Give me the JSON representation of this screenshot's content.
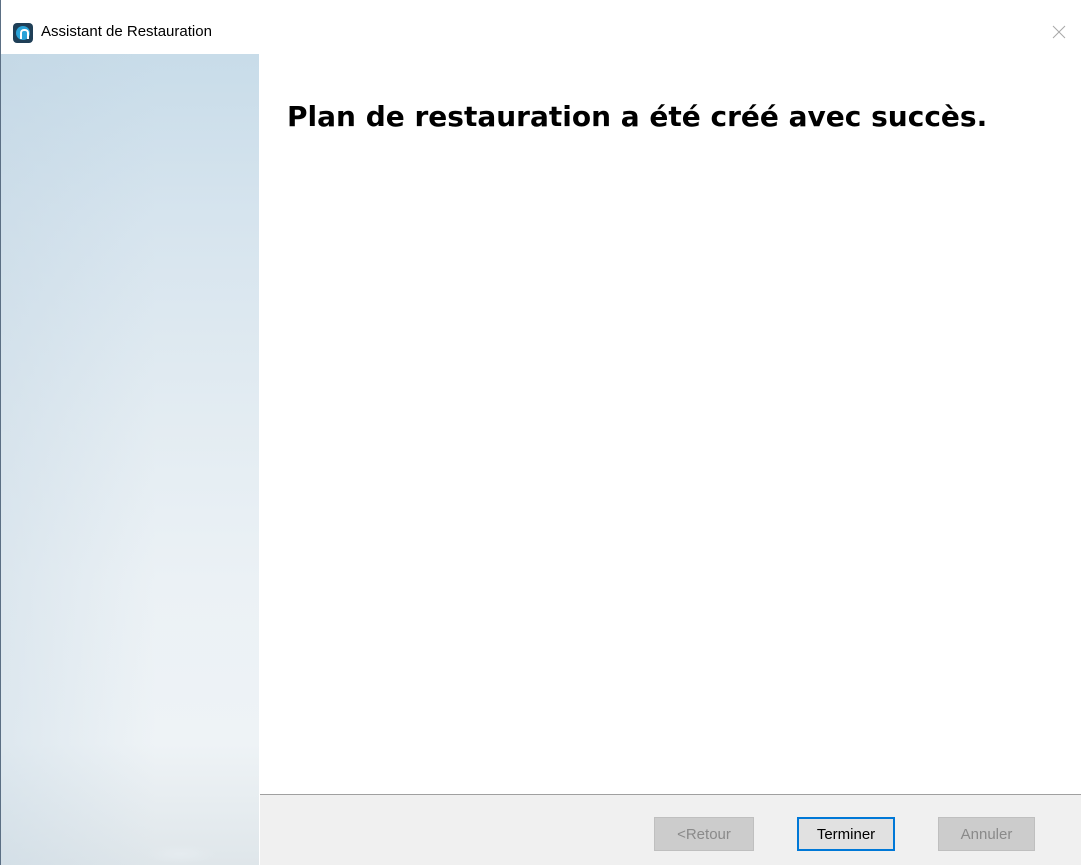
{
  "window": {
    "title": "Assistant de Restauration"
  },
  "main": {
    "heading": "Plan de restauration a été créé avec succès."
  },
  "footer": {
    "back_label": "<Retour",
    "finish_label": "Terminer",
    "cancel_label": "Annuler"
  },
  "icons": {
    "app": "app-logo-icon",
    "close": "close-icon"
  },
  "colors": {
    "accent": "#0078d7",
    "footer_bg": "#f0f0f0",
    "disabled_button": "#cccccc",
    "disabled_text": "#8a8a8a"
  },
  "state": {
    "back_enabled": false,
    "cancel_enabled": false,
    "finish_focused": true
  }
}
